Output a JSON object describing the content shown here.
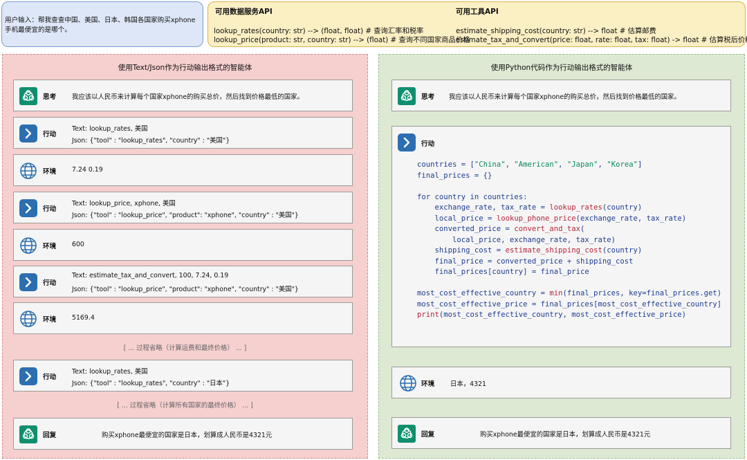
{
  "user_input": "用户输入：帮我查查中国、美国、日本、韩国各国家购买xphone手机最便宜的是哪个。",
  "data_api": {
    "title": "可用数据服务API",
    "lines": [
      "lookup_rates(country: str) --> (float, float) # 查询汇率和税率",
      "lookup_price(product: str, country: str) --> (float) # 查询不同国家商品价格"
    ]
  },
  "tool_api": {
    "title": "可用工具API",
    "lines": [
      "estimate_shipping_cost(country: str) --> float # 估算邮费",
      "estimate_tax_and_convert(price: float, rate: float, tax: float) -> float # 估算税后价格"
    ]
  },
  "left": {
    "title": "使用Text/Json作为行动输出格式的智能体",
    "think": {
      "label": "思考",
      "text": "我应该以人民币来计算每个国家xphone的购买总价，然后找到价格最低的国家。"
    },
    "act1": {
      "label": "行动",
      "text": "Text:   lookup_rates, 美国",
      "json": "Json:   {\"tool\" : \"lookup_rates\", \"country\" : \"美国\"}"
    },
    "env1": {
      "label": "环境",
      "text": "7.24 0.19"
    },
    "act2": {
      "label": "行动",
      "text": "Text:   lookup_price, xphone, 美国",
      "json": "Json:   {\"tool\" : \"lookup_price\", \"product\": \"xphone\", \"country\" : \"美国\"}"
    },
    "env2": {
      "label": "环境",
      "text": "600"
    },
    "act3": {
      "label": "行动",
      "text": "Text:   estimate_tax_and_convert, 100, 7.24, 0.19",
      "json": "Json:   {\"tool\" : \"lookup_price\", \"product\": \"xphone\", \"country\" : \"美国\"}"
    },
    "env3": {
      "label": "环境",
      "text": "5169.4"
    },
    "omit1": "[ ... 过程省略（计算运费和最终价格） ... ]",
    "act4": {
      "label": "行动",
      "text": "Text:   lookup_rates, 美国",
      "json": "Json:   {\"tool\" : \"lookup_rates\", \"country\" : \"日本\"}"
    },
    "omit2": "[ ... 过程省略（计算所有国家的最终价格） ... ]",
    "reply": {
      "label": "回复",
      "text": "购买xphone最便宜的国家是日本，划算成人民币是4321元"
    }
  },
  "right": {
    "title": "使用Python代码作为行动输出格式的智能体",
    "think": {
      "label": "思考",
      "text": "我应该以人民币来计算每个国家xphone的购买总价，然后找到价格最低的国家。"
    },
    "act": {
      "label": "行动"
    },
    "code_lines": [
      "countries = [\"China\", \"American\", \"Japan\", \"Korea\"]",
      "final_prices = {}",
      "",
      "for country in countries:",
      "    exchange_rate, tax_rate = lookup_rates(country)",
      "    local_price = lookup_phone_price(exchange_rate, tax_rate)",
      "    converted_price = convert_and_tax(",
      "        local_price, exchange_rate, tax_rate)",
      "    shipping_cost = estimate_shipping_cost(country)",
      "    final_price = converted_price + shipping_cost",
      "    final_prices[country] = final_price",
      "",
      "most_cost_effective_country = min(final_prices, key=final_prices.get)",
      "most_cost_effective_price = final_prices[most_cost_effective_country]",
      "print(most_cost_effective_country, most_cost_effective_price)"
    ],
    "env": {
      "label": "环境",
      "text": "日本，4321"
    },
    "reply": {
      "label": "回复",
      "text": "购买xphone最便宜的国家是日本，划算成人民币是4321元"
    }
  },
  "colors": {
    "user_box": "#dde7f7",
    "api_box": "#fbefc4",
    "left_panel": "#f6cfcf",
    "right_panel": "#dde9d2",
    "openai_green": "#0f8f6e",
    "action_blue": "#2b6fb0"
  },
  "icons": {
    "think": "openai-logo-icon",
    "act": "chevron-right-icon",
    "env": "globe-icon",
    "reply": "openai-logo-icon"
  }
}
